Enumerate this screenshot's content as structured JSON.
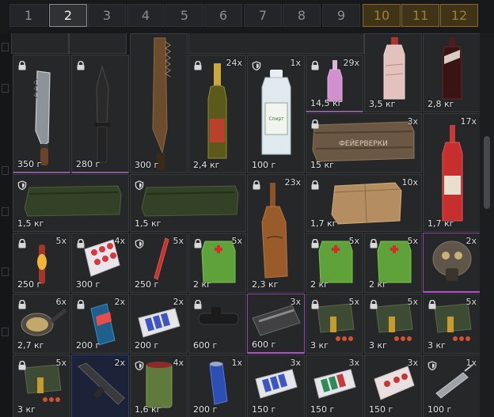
{
  "tabs": [
    {
      "label": "1",
      "state": "normal"
    },
    {
      "label": "2",
      "state": "active"
    },
    {
      "label": "3",
      "state": "normal"
    },
    {
      "label": "4",
      "state": "normal"
    },
    {
      "label": "5",
      "state": "normal"
    },
    {
      "label": "6",
      "state": "normal"
    },
    {
      "label": "7",
      "state": "normal"
    },
    {
      "label": "8",
      "state": "normal"
    },
    {
      "label": "9",
      "state": "normal"
    },
    {
      "label": "10",
      "state": "locked"
    },
    {
      "label": "11",
      "state": "locked"
    },
    {
      "label": "12",
      "state": "locked"
    }
  ],
  "items": {
    "knife_serrated": {
      "weight": "350 г",
      "badge": "lock-icon"
    },
    "knife_combat": {
      "weight": "280 г",
      "badge": "lock-icon"
    },
    "knife_saw": {
      "weight": "300 г",
      "badge": "none"
    },
    "champagne": {
      "qty": "24x",
      "weight": "2,4 кг",
      "badge": "lock-icon"
    },
    "alcohol_bottle": {
      "qty": "1x",
      "weight": "100 г",
      "badge": "shield-icon",
      "label": "Спирт"
    },
    "pink_bottle": {
      "qty": "29x",
      "weight": "14,5 кг",
      "badge": "lock-icon"
    },
    "milky_bottle": {
      "weight": "3,5 кг",
      "badge": "none"
    },
    "wine_bottle": {
      "weight": "2,8 кг",
      "badge": "none"
    },
    "fireworks_crate": {
      "qty": "3x",
      "weight": "15 кг",
      "badge": "lock-icon",
      "label": "ФЕЙЕРВЕРКИ"
    },
    "vodka_bottle": {
      "qty": "17x",
      "weight": "1,7 кг",
      "badge": "none"
    },
    "green_crate_1": {
      "weight": "1,5 кг",
      "badge": "shield-icon"
    },
    "green_crate_2": {
      "weight": "1,5 кг",
      "badge": "shield-icon"
    },
    "brown_bottle": {
      "qty": "23x",
      "weight": "2,3 кг",
      "badge": "lock-icon"
    },
    "cardboard_box": {
      "qty": "10x",
      "weight": "1,7 кг",
      "badge": "lock-icon"
    },
    "flare": {
      "qty": "5x",
      "weight": "250 г",
      "badge": "lock-icon"
    },
    "pills": {
      "qty": "4x",
      "weight": "300 г",
      "badge": "lock-icon"
    },
    "red_stick": {
      "qty": "5x",
      "weight": "250 г",
      "badge": "shield-icon"
    },
    "medkit_1": {
      "qty": "5x",
      "weight": "2 кг",
      "badge": "lock-icon"
    },
    "medkit_2": {
      "qty": "5x",
      "weight": "2 кг",
      "badge": "lock-icon"
    },
    "medkit_3": {
      "qty": "5x",
      "weight": "2 кг",
      "badge": "lock-icon"
    },
    "mask_helmet": {
      "qty": "2x",
      "badge": "none"
    },
    "frying_pan": {
      "qty": "6x",
      "weight": "2,7 кг",
      "badge": "lock-icon"
    },
    "energy_drink": {
      "qty": "2x",
      "weight": "200 г",
      "badge": "lock-icon"
    },
    "batteries": {
      "qty": "2x",
      "weight": "200 г",
      "badge": "none"
    },
    "scope": {
      "weight": "600 г",
      "badge": "lock-icon"
    },
    "weapon_case": {
      "qty": "3x",
      "weight": "600 г",
      "badge": "none"
    },
    "grenade_pack_1": {
      "qty": "5x",
      "weight": "3 кг",
      "badge": "lock-icon"
    },
    "grenade_pack_2": {
      "qty": "5x",
      "weight": "3 кг",
      "badge": "lock-icon"
    },
    "grenade_pack_3": {
      "qty": "5x",
      "weight": "3 кг",
      "badge": "lock-icon"
    },
    "grenade_pack_4": {
      "qty": "5x",
      "weight": "3 кг",
      "badge": "lock-icon"
    },
    "rifle_part": {
      "qty": "2x",
      "badge": "none"
    },
    "tin_can": {
      "qty": "4x",
      "weight": "1,6 кг",
      "badge": "shield-icon"
    },
    "blue_can": {
      "qty": "1x",
      "weight": "200 г",
      "badge": "none"
    },
    "batteries_2": {
      "qty": "3x",
      "weight": "150 г",
      "badge": "none"
    },
    "batteries_3": {
      "qty": "3x",
      "weight": "150 г",
      "badge": "none"
    },
    "pill_pack": {
      "qty": "3x",
      "weight": "150 г",
      "badge": "none"
    },
    "syringe": {
      "qty": "1x",
      "weight": "100 г",
      "badge": "shield-icon"
    }
  }
}
